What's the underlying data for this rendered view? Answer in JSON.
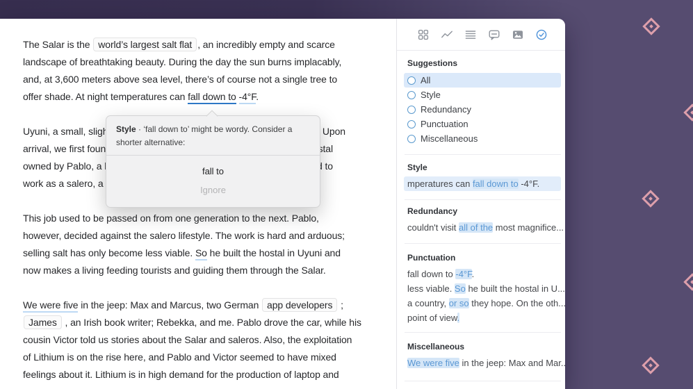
{
  "editor": {
    "paragraphs": [
      {
        "lines": [
          {
            "f": [
              {
                "t": "The Salar is the "
              },
              {
                "t": "world’s largest salt flat",
                "s": "box"
              },
              {
                "t": ", an incredibly empty and scarce"
              }
            ]
          },
          {
            "f": [
              {
                "t": "landscape of breathtaking beauty. During the day the sun burns implacably,"
              }
            ]
          },
          {
            "f": [
              {
                "t": "and, at 3,600 meters above sea level, there’s of course not a single tree to"
              }
            ]
          },
          {
            "f": [
              {
                "t": "offer shade. At night temperatures can "
              },
              {
                "t": "fall down to",
                "s": "ustrong"
              },
              {
                "t": " "
              },
              {
                "t": "-4°F",
                "s": "ulight"
              },
              {
                "t": "."
              }
            ]
          }
        ]
      },
      {
        "lines": [
          {
            "f": [
              {
                "t": "Uyuni, a small, sligh"
              }
            ],
            "r": [
              {
                "t": ". Upon"
              }
            ]
          },
          {
            "f": [
              {
                "t": "arrival, we first foun"
              }
            ],
            "r": [
              {
                "t": "stal"
              }
            ]
          },
          {
            "f": [
              {
                "t": "owned by Pablo, a h"
              }
            ],
            "r": [
              {
                "t": "d to"
              }
            ]
          },
          {
            "f": [
              {
                "t": "work as a salero, a s"
              }
            ]
          }
        ]
      },
      {
        "lines": [
          {
            "f": [
              {
                "t": "This job used to be passed on from one generation to the next. Pablo,"
              }
            ]
          },
          {
            "f": [
              {
                "t": "however, decided against the salero lifestyle. The work is hard and arduous;"
              }
            ]
          },
          {
            "f": [
              {
                "t": "selling salt has only become less viable. "
              },
              {
                "t": "So",
                "s": "ulight"
              },
              {
                "t": " he built the hostal in Uyuni and"
              }
            ]
          },
          {
            "f": [
              {
                "t": "now makes a living feeding tourists and guiding them through the Salar."
              }
            ]
          }
        ]
      },
      {
        "lines": [
          {
            "f": [
              {
                "t": "We were five",
                "s": "ulight"
              },
              {
                "t": " in the jeep: Max and Marcus, two German "
              },
              {
                "t": "app developers",
                "s": "box"
              },
              {
                "t": " ;"
              }
            ]
          },
          {
            "f": [
              {
                "t": "James",
                "s": "box"
              },
              {
                "t": " , an Irish book writer; Rebekka, and me. Pablo drove the car, while his"
              }
            ]
          },
          {
            "f": [
              {
                "t": "cousin Victor told us stories about the Salar and saleros. Also, the exploitation"
              }
            ]
          },
          {
            "f": [
              {
                "t": "of Lithium is on the rise here, and Pablo and Victor seemed to have mixed"
              }
            ]
          },
          {
            "f": [
              {
                "t": "feelings about it. Lithium is in high demand for the production of laptop and"
              }
            ]
          }
        ]
      }
    ]
  },
  "tooltip": {
    "category": "Style",
    "dot": " · ",
    "message": "‘fall down to’ might be wordy. Consider a shorter alternative:",
    "suggestion": "fall to",
    "ignore": "Ignore"
  },
  "toolbar": {
    "icons": [
      {
        "name": "grid-icon"
      },
      {
        "name": "trend-icon"
      },
      {
        "name": "list-icon"
      },
      {
        "name": "comment-icon"
      },
      {
        "name": "image-icon"
      },
      {
        "name": "badge-check-icon",
        "active": true
      }
    ]
  },
  "sidebar": {
    "title": "Suggestions",
    "filters": [
      {
        "label": "All",
        "active": true
      },
      {
        "label": "Style"
      },
      {
        "label": "Redundancy"
      },
      {
        "label": "Punctuation"
      },
      {
        "label": "Miscellaneous"
      }
    ],
    "sections": [
      {
        "title": "Style",
        "items": [
          {
            "selected": true,
            "f": [
              {
                "t": "mperatures can "
              },
              {
                "t": "fall down to",
                "s": "hl"
              },
              {
                "t": " -4°F."
              }
            ]
          }
        ]
      },
      {
        "title": "Redundancy",
        "items": [
          {
            "f": [
              {
                "t": "couldn't visit "
              },
              {
                "t": "all of the",
                "s": "hl"
              },
              {
                "t": " most magnifice..."
              }
            ]
          }
        ]
      },
      {
        "title": "Punctuation",
        "items": [
          {
            "f": [
              {
                "t": "fall down to "
              },
              {
                "t": "-4°F",
                "s": "hl"
              },
              {
                "t": "."
              }
            ]
          },
          {
            "f": [
              {
                "t": "less viable. "
              },
              {
                "t": "So",
                "s": "hl"
              },
              {
                "t": " he built the hostal in U..."
              }
            ]
          },
          {
            "f": [
              {
                "t": "a country, "
              },
              {
                "t": "or so",
                "s": "hl"
              },
              {
                "t": " they hope. On the oth..."
              }
            ]
          },
          {
            "f": [
              {
                "t": "point of view"
              },
              {
                "t": ".",
                "s": "hl"
              }
            ]
          }
        ]
      },
      {
        "title": "Miscellaneous",
        "items": [
          {
            "f": [
              {
                "t": "We were five",
                "s": "hl"
              },
              {
                "t": " in the jeep: Max and Mar..."
              }
            ]
          }
        ]
      }
    ]
  },
  "colors": {
    "accent_blue": "#4a90d9",
    "highlight_blue": "#d5e6f7",
    "desktop_purple": "#564c70",
    "diamond_pink": "#dd9fab"
  }
}
